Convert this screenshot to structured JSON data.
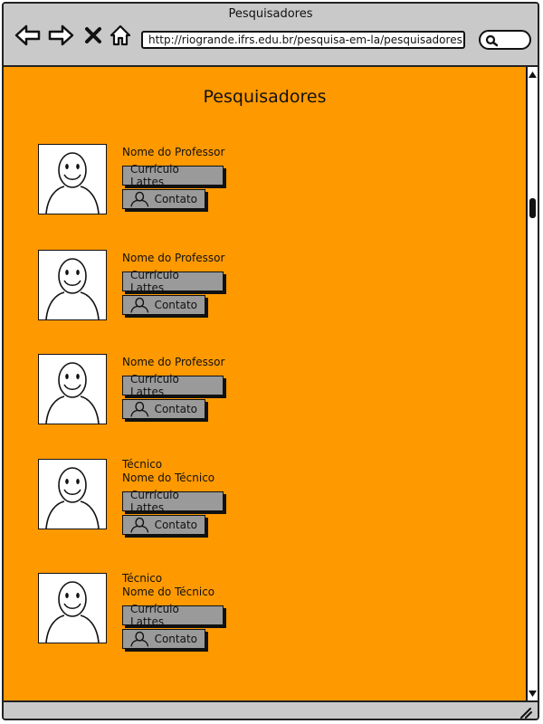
{
  "window": {
    "title": "Pesquisadores",
    "url": "http://riogrande.ifrs.edu.br/pesquisa-em-la/pesquisadores"
  },
  "page": {
    "heading": "Pesquisadores"
  },
  "researchers": [
    {
      "role": "",
      "name": "Nome do Professor",
      "lattes_label": "Currículo Lattes",
      "contact_label": "Contato"
    },
    {
      "role": "",
      "name": "Nome do Professor",
      "lattes_label": "Currículo Lattes",
      "contact_label": "Contato"
    },
    {
      "role": "",
      "name": "Nome do Professor",
      "lattes_label": "Currículo Lattes",
      "contact_label": "Contato"
    },
    {
      "role": "Técnico",
      "name": "Nome do Técnico",
      "lattes_label": "Currículo Lattes",
      "contact_label": "Contato"
    },
    {
      "role": "Técnico",
      "name": "Nome do Técnico",
      "lattes_label": "Currículo Lattes",
      "contact_label": "Contato"
    }
  ],
  "icons": {
    "back": "arrow-left-icon",
    "forward": "arrow-right-icon",
    "stop": "close-icon",
    "home": "home-icon",
    "search": "search-icon",
    "contact": "user-icon",
    "avatar": "smiley-person-icon",
    "resize": "resize-grip-icon"
  },
  "colors": {
    "content_bg": "#ff9900",
    "chrome_bg": "#c9c9c9",
    "button_bg": "#9a9a9a"
  }
}
